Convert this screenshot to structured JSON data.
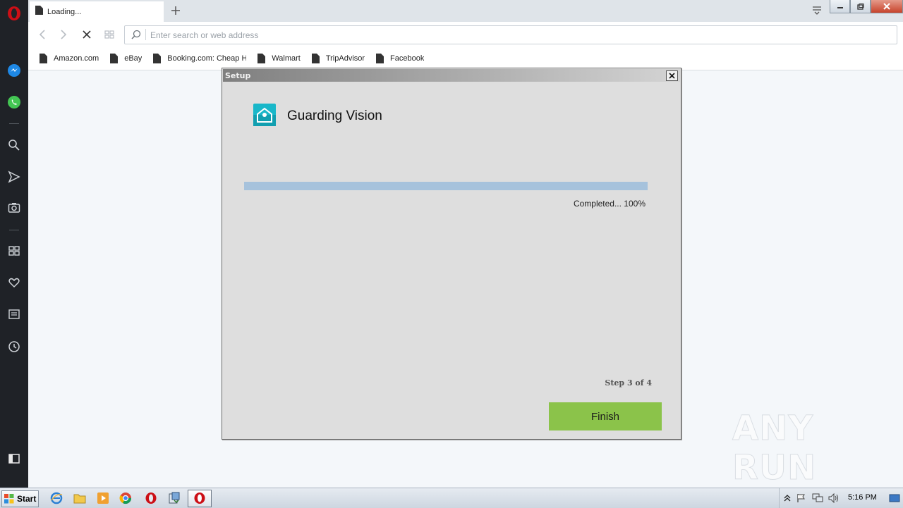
{
  "browser": {
    "tab": {
      "label": "Loading..."
    },
    "address_bar": {
      "placeholder": "Enter search or web address",
      "value": ""
    },
    "bookmarks": [
      {
        "label": "Amazon.com"
      },
      {
        "label": "eBay"
      },
      {
        "label": "Booking.com: Cheap Hc"
      },
      {
        "label": "Walmart"
      },
      {
        "label": "TripAdvisor"
      },
      {
        "label": "Facebook"
      }
    ]
  },
  "dialog": {
    "title": "Setup",
    "app_name": "Guarding Vision",
    "progress": {
      "percent": 100,
      "text": "Completed... 100%"
    },
    "step_text": "Step 3 of 4",
    "finish_label": "Finish"
  },
  "watermark": {
    "text": "ANY RUN"
  },
  "taskbar": {
    "start_label": "Start",
    "clock": "5:16 PM"
  },
  "colors": {
    "opera_red": "#cc0f16",
    "finish_green": "#8bc34a",
    "progress_fill": "#a6c2dc",
    "sidebar_bg": "#1f2227"
  }
}
